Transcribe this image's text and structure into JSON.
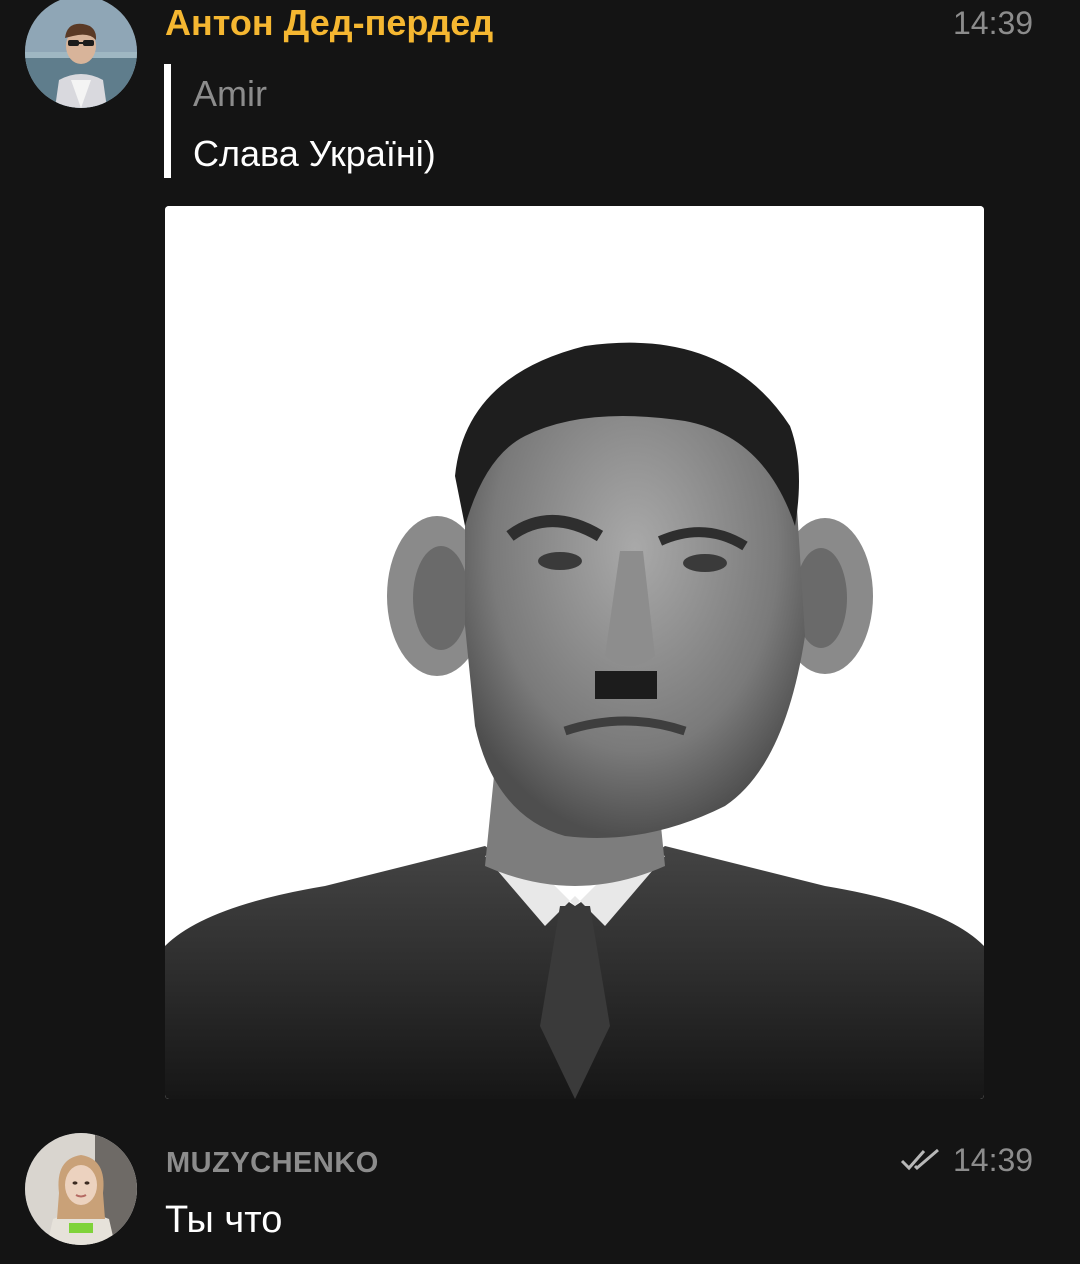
{
  "messages": [
    {
      "sender": "Антон Дед-пердед",
      "sender_color": "#f5b731",
      "time": "14:39",
      "reply": {
        "author": "Amir",
        "text": "Слава Україні)"
      },
      "has_photo": true
    },
    {
      "sender": "MUZYCHENKO",
      "sender_color": "#8c8c8c",
      "time": "14:39",
      "status_icon": "double-check-icon",
      "text": "Ты что"
    }
  ]
}
